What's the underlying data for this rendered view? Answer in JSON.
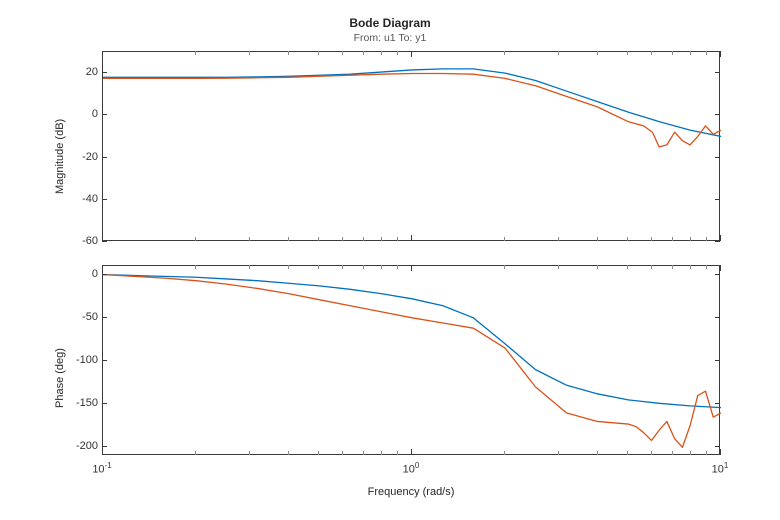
{
  "title": "Bode Diagram",
  "subtitle": "From: u1  To: y1",
  "xlabel": "Frequency (rad/s)",
  "panels": {
    "mag": {
      "ylabel": "Magnitude (dB)",
      "ylim": [
        -60,
        30
      ],
      "yticks": [
        -60,
        -40,
        -20,
        0,
        20
      ]
    },
    "phase": {
      "ylabel": "Phase (deg)",
      "ylim": [
        -210,
        10
      ],
      "yticks": [
        -200,
        -150,
        -100,
        -50,
        0
      ]
    }
  },
  "xlim_log10": [
    -1,
    1
  ],
  "xtick_labels": [
    "10",
    "10",
    "10"
  ],
  "xtick_exponents": [
    "-1",
    "0",
    "1"
  ],
  "colors": {
    "seriesA": "#0072BD",
    "seriesB": "#D95319",
    "axis": "#3a3a3a"
  },
  "chart_data": [
    {
      "type": "line",
      "title": "Bode Diagram — Magnitude",
      "xlabel": "Frequency (rad/s)",
      "ylabel": "Magnitude (dB)",
      "xscale": "log",
      "xlim": [
        0.1,
        10
      ],
      "ylim": [
        -60,
        30
      ],
      "x": [
        0.1,
        0.126,
        0.158,
        0.2,
        0.251,
        0.316,
        0.398,
        0.501,
        0.631,
        0.794,
        1.0,
        1.26,
        1.58,
        2.0,
        2.51,
        3.16,
        3.98,
        5.01,
        6.31,
        7.94,
        10.0
      ],
      "series": [
        {
          "name": "blue",
          "color": "#0072BD",
          "values": [
            18,
            18,
            18,
            18,
            18,
            18.2,
            18.5,
            19,
            19.5,
            20.5,
            21.5,
            22,
            22,
            20,
            16.5,
            11.5,
            6.5,
            1.5,
            -3,
            -7,
            -10
          ]
        },
        {
          "name": "orange",
          "color": "#D95319",
          "values": [
            17.5,
            17.5,
            17.5,
            17.5,
            17.6,
            17.8,
            18,
            18.5,
            19,
            19.5,
            19.8,
            19.8,
            19.5,
            17.5,
            14,
            9,
            4,
            -3,
            -15,
            -14,
            -7
          ]
        }
      ],
      "orange_extra": {
        "x": [
          5.01,
          5.62,
          6.0,
          6.31,
          6.68,
          7.08,
          7.5,
          7.94,
          8.41,
          8.91,
          9.44,
          10.0
        ],
        "values": [
          -3,
          -5,
          -8,
          -15,
          -14,
          -8,
          -12,
          -14,
          -10,
          -5,
          -9,
          -7
        ]
      }
    },
    {
      "type": "line",
      "title": "Bode Diagram — Phase",
      "xlabel": "Frequency (rad/s)",
      "ylabel": "Phase (deg)",
      "xscale": "log",
      "xlim": [
        0.1,
        10
      ],
      "ylim": [
        -210,
        10
      ],
      "x": [
        0.1,
        0.126,
        0.158,
        0.2,
        0.251,
        0.316,
        0.398,
        0.501,
        0.631,
        0.794,
        1.0,
        1.26,
        1.58,
        2.0,
        2.51,
        3.16,
        3.98,
        5.01,
        6.31,
        7.94,
        10.0
      ],
      "series": [
        {
          "name": "blue",
          "color": "#0072BD",
          "values": [
            0,
            -1,
            -2,
            -3,
            -5,
            -7,
            -10,
            -13,
            -17,
            -22,
            -28,
            -36,
            -50,
            -80,
            -110,
            -128,
            -138,
            -145,
            -149,
            -152,
            -154
          ]
        },
        {
          "name": "orange",
          "color": "#D95319",
          "values": [
            0,
            -2,
            -4,
            -7,
            -11,
            -16,
            -22,
            -29,
            -36,
            -43,
            -50,
            -56,
            -62,
            -85,
            -130,
            -160,
            -170,
            -173,
            -180,
            -175,
            -160
          ]
        }
      ],
      "orange_extra": {
        "x": [
          5.01,
          5.31,
          5.62,
          5.96,
          6.31,
          6.68,
          7.08,
          7.5,
          7.94,
          8.41,
          8.91,
          9.44,
          10.0
        ],
        "values": [
          -173,
          -176,
          -183,
          -192,
          -180,
          -170,
          -190,
          -200,
          -175,
          -140,
          -135,
          -165,
          -160
        ]
      }
    }
  ]
}
